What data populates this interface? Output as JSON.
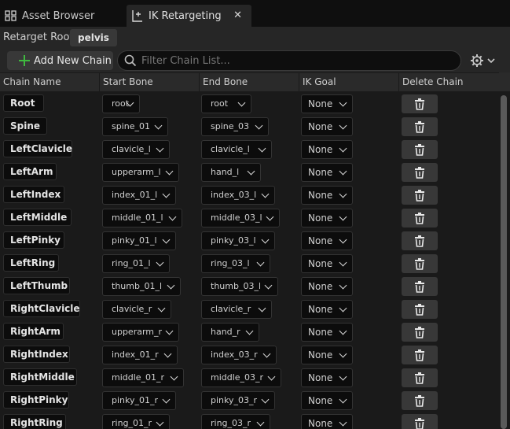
{
  "tabs": [
    {
      "label": "Asset Browser",
      "icon": "asset-browser-icon"
    },
    {
      "label": "IK Retargeting",
      "icon": "ik-retargeting-icon",
      "close": "✕"
    }
  ],
  "retarget_root": {
    "label": "Retarget Root:",
    "value": "pelvis"
  },
  "toolbar": {
    "add_label": "Add New Chain",
    "search_placeholder": "Filter Chain List...",
    "settings_icon": "gear-icon"
  },
  "columns": [
    "Chain Name",
    "Start Bone",
    "End Bone",
    "IK Goal",
    "Delete Chain"
  ],
  "rows": [
    {
      "chain": "Root",
      "start": "root",
      "end": "root",
      "goal": "None"
    },
    {
      "chain": "Spine",
      "start": "spine_01",
      "end": "spine_03",
      "goal": "None"
    },
    {
      "chain": "LeftClavicle",
      "start": "clavicle_l",
      "end": "clavicle_l",
      "goal": "None"
    },
    {
      "chain": "LeftArm",
      "start": "upperarm_l",
      "end": "hand_l",
      "goal": "None"
    },
    {
      "chain": "LeftIndex",
      "start": "index_01_l",
      "end": "index_03_l",
      "goal": "None"
    },
    {
      "chain": "LeftMiddle",
      "start": "middle_01_l",
      "end": "middle_03_l",
      "goal": "None"
    },
    {
      "chain": "LeftPinky",
      "start": "pinky_01_l",
      "end": "pinky_03_l",
      "goal": "None"
    },
    {
      "chain": "LeftRing",
      "start": "ring_01_l",
      "end": "ring_03_l",
      "goal": "None"
    },
    {
      "chain": "LeftThumb",
      "start": "thumb_01_l",
      "end": "thumb_03_l",
      "goal": "None"
    },
    {
      "chain": "RightClavicle",
      "start": "clavicle_r",
      "end": "clavicle_r",
      "goal": "None"
    },
    {
      "chain": "RightArm",
      "start": "upperarm_r",
      "end": "hand_r",
      "goal": "None"
    },
    {
      "chain": "RightIndex",
      "start": "index_01_r",
      "end": "index_03_r",
      "goal": "None"
    },
    {
      "chain": "RightMiddle",
      "start": "middle_01_r",
      "end": "middle_03_r",
      "goal": "None"
    },
    {
      "chain": "RightPinky",
      "start": "pinky_01_r",
      "end": "pinky_03_r",
      "goal": "None"
    },
    {
      "chain": "RightRing",
      "start": "ring_01_r",
      "end": "ring_03_r",
      "goal": "None"
    }
  ],
  "colors": {
    "background": "#151515",
    "panel": "#262626",
    "add_icon": "#3fb93f"
  }
}
